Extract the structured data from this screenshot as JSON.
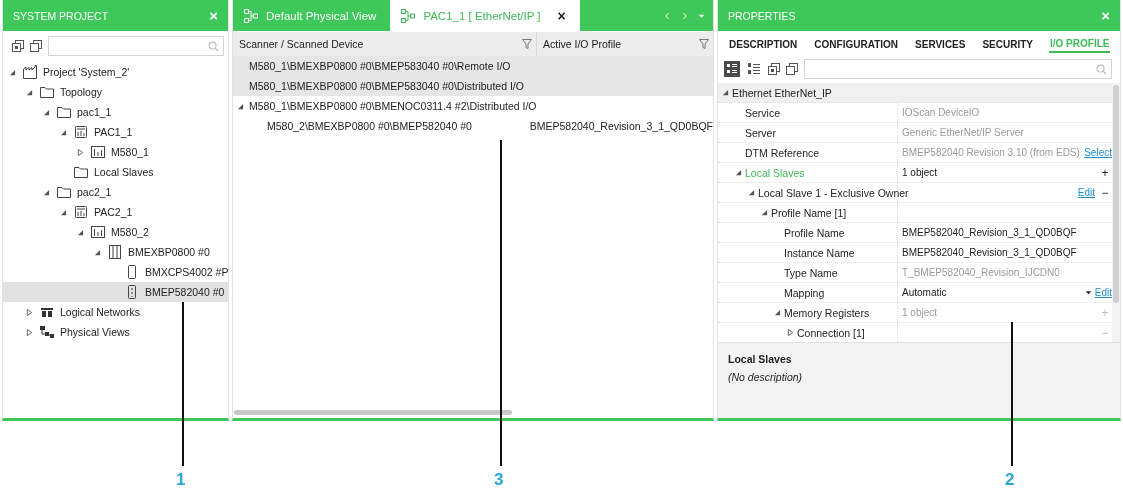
{
  "left_panel": {
    "title": "SYSTEM PROJECT",
    "close": "×",
    "tree": [
      {
        "label": "Project 'System_2'",
        "kind": "project",
        "expanded": true,
        "selected": false,
        "children": [
          {
            "label": "Topology",
            "kind": "folder",
            "expanded": true,
            "selected": false,
            "children": [
              {
                "label": "pac1_1",
                "kind": "folder",
                "expanded": true,
                "selected": false,
                "children": [
                  {
                    "label": "PAC1_1",
                    "kind": "controller",
                    "expanded": true,
                    "selected": false,
                    "children": [
                      {
                        "label": "M580_1",
                        "kind": "cpu",
                        "expanded": false,
                        "selected": false
                      }
                    ]
                  },
                  {
                    "label": "Local Slaves",
                    "kind": "folder",
                    "selected": false
                  }
                ]
              },
              {
                "label": "pac2_1",
                "kind": "folder",
                "expanded": true,
                "selected": false,
                "children": [
                  {
                    "label": "PAC2_1",
                    "kind": "controller",
                    "expanded": true,
                    "selected": false,
                    "children": [
                      {
                        "label": "M580_2",
                        "kind": "cpu",
                        "expanded": true,
                        "selected": false,
                        "children": [
                          {
                            "label": "BMEXBP0800 #0",
                            "kind": "rack",
                            "expanded": true,
                            "selected": false,
                            "children": [
                              {
                                "label": "BMXCPS4002 #P",
                                "kind": "module",
                                "selected": false
                              },
                              {
                                "label": "BMEP582040 #0",
                                "kind": "cpu_module",
                                "selected": true
                              }
                            ]
                          }
                        ]
                      }
                    ]
                  }
                ]
              }
            ]
          },
          {
            "label": "Logical Networks",
            "kind": "network",
            "expanded": false,
            "selected": false
          },
          {
            "label": "Physical Views",
            "kind": "physical",
            "expanded": false,
            "selected": false
          }
        ]
      }
    ]
  },
  "middle_panel": {
    "tabs": [
      {
        "label": "Default Physical View",
        "selected": false
      },
      {
        "label": "PAC1_1 [ EtherNet/IP ]",
        "selected": true,
        "close": "×"
      }
    ],
    "table": {
      "columns": [
        "Scanner / Scanned Device",
        "Active I/O Profile"
      ],
      "rows": [
        {
          "cells": [
            "M580_1\\BMEXBP0800 #0\\BMEP583040 #0\\Remote I/O",
            ""
          ],
          "selected": true
        },
        {
          "cells": [
            "M580_1\\BMEXBP0800 #0\\BMEP583040 #0\\Distributed I/O",
            ""
          ],
          "selected": true
        },
        {
          "cells": [
            "M580_1\\BMEXBP0800 #0\\BMENOC0311.4 #2\\Distributed I/O",
            ""
          ],
          "selected": false,
          "expanded": true,
          "children": [
            {
              "cells": [
                "M580_2\\BMEXBP0800 #0\\BMEP582040 #0",
                "BMEP582040_Revision_3_1_QD0BQF"
              ],
              "selected": false
            }
          ]
        }
      ]
    }
  },
  "right_panel": {
    "title": "PROPERTIES",
    "close": "×",
    "tabs": [
      {
        "label": "DESCRIPTION",
        "selected": false
      },
      {
        "label": "CONFIGURATION",
        "selected": false
      },
      {
        "label": "SERVICES",
        "selected": false
      },
      {
        "label": "SECURITY",
        "selected": false
      },
      {
        "label": "I/O PROFILE",
        "selected": true
      }
    ],
    "rows": [
      {
        "kind": "category",
        "name": "Ethernet EtherNet_IP",
        "expanded": true,
        "selected": false,
        "children": [
          {
            "kind": "property",
            "name": "Service",
            "value": "IOScan DeviceIO",
            "disabled": true,
            "selected": false
          },
          {
            "kind": "property",
            "name": "Server",
            "value": "Generic EtherNet/IP Server",
            "disabled": true,
            "selected": false
          },
          {
            "kind": "property",
            "name": "DTM Reference",
            "value": "BMEP582040 Revision 3.10 (from EDS)",
            "disabled": true,
            "link": "Select",
            "selected": false
          },
          {
            "kind": "property",
            "name": "Local Slaves",
            "value": "1 object",
            "disabled": false,
            "action": "+",
            "action_disabled": false,
            "expanded": true,
            "selected": true,
            "children": [
              {
                "kind": "property",
                "name": "Local Slave 1 - Exclusive Owner",
                "link": "Edit",
                "action": "−",
                "action_disabled": false,
                "expanded": true,
                "selected": false,
                "children": [
                  {
                    "kind": "property",
                    "name": "Profile Name [1]",
                    "expanded": true,
                    "selected": false,
                    "children": [
                      {
                        "kind": "property",
                        "name": "Profile Name",
                        "value": "BMEP582040_Revision_3_1_QD0BQF",
                        "disabled": false,
                        "selected": false
                      },
                      {
                        "kind": "property",
                        "name": "Instance Name",
                        "value": "BMEP582040_Revision_3_1_QD0BQF",
                        "disabled": false,
                        "selected": false
                      },
                      {
                        "kind": "property",
                        "name": "Type Name",
                        "value": "T_BMEP582040_Revision_IJCDN0",
                        "disabled": true,
                        "selected": false
                      },
                      {
                        "kind": "dropdown",
                        "name": "Mapping",
                        "value": "Automatic",
                        "disabled": false,
                        "link": "Edit",
                        "selected": false
                      },
                      {
                        "kind": "property",
                        "name": "Memory Registers",
                        "value": "1 object",
                        "disabled": true,
                        "action": "+",
                        "action_disabled": true,
                        "expanded": true,
                        "selected": false,
                        "children": [
                          {
                            "kind": "property",
                            "name": "Connection [1]",
                            "action": "−",
                            "action_disabled": true,
                            "expanded": false,
                            "selected": false
                          }
                        ]
                      }
                    ]
                  }
                ]
              }
            ]
          }
        ]
      }
    ],
    "description": {
      "title": "Local Slaves",
      "text": "(No description)"
    }
  },
  "callouts": [
    {
      "label": "1"
    },
    {
      "label": "3"
    },
    {
      "label": "2"
    }
  ]
}
